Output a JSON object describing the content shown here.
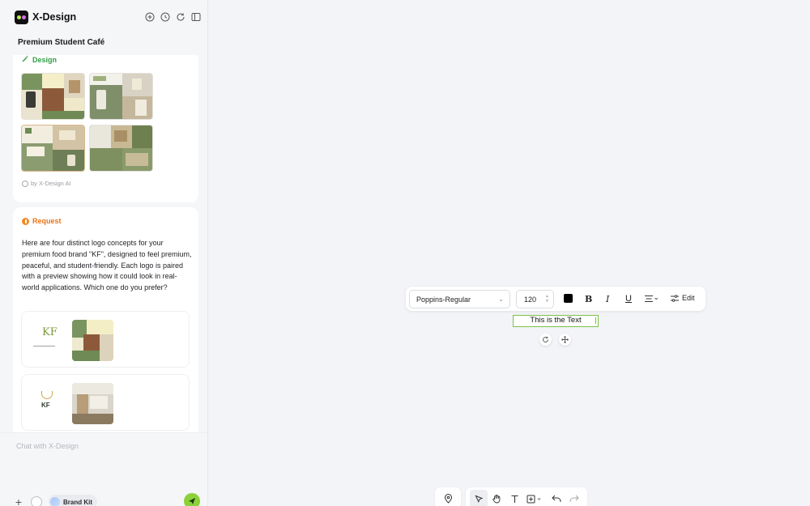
{
  "app": {
    "name": "X-Design"
  },
  "project": {
    "title": "Premium Student Café"
  },
  "design_card": {
    "heading": "Design",
    "by_line": "by X-Design AI",
    "thumbnails": [
      "design-concept-1",
      "design-concept-2",
      "design-concept-3",
      "design-concept-4"
    ]
  },
  "request_card": {
    "heading": "Request",
    "text": "Here are four distinct logo concepts for your premium food brand \"KF\", designed to feel premium, peaceful, and student-friendly. Each logo is paired with a preview showing how it could look in real-world applications. Which one do you prefer?",
    "concept1_mark": "KF",
    "concept2_mark": "KF"
  },
  "chat": {
    "placeholder": "Chat with X-Design",
    "brand_kit_label": "Brand Kit"
  },
  "text_toolbar": {
    "font": "Poppins-Regular",
    "size": "120",
    "color": "#000000",
    "bold_label": "B",
    "italic_label": "I",
    "underline_label": "U",
    "edit_label": "Edit"
  },
  "canvas": {
    "text_box": "This is the Text"
  },
  "colors": {
    "accent_green": "#7dc047",
    "design_green": "#2f9e44",
    "request_orange": "#e8741c",
    "send_green": "#8bd13a"
  },
  "icons": [
    "new-chat-icon",
    "history-icon",
    "refresh-icon",
    "panel-toggle-icon",
    "location-pin-icon",
    "select-pointer-icon",
    "hand-pan-icon",
    "text-tool-icon",
    "add-frame-icon",
    "undo-icon",
    "redo-icon"
  ]
}
